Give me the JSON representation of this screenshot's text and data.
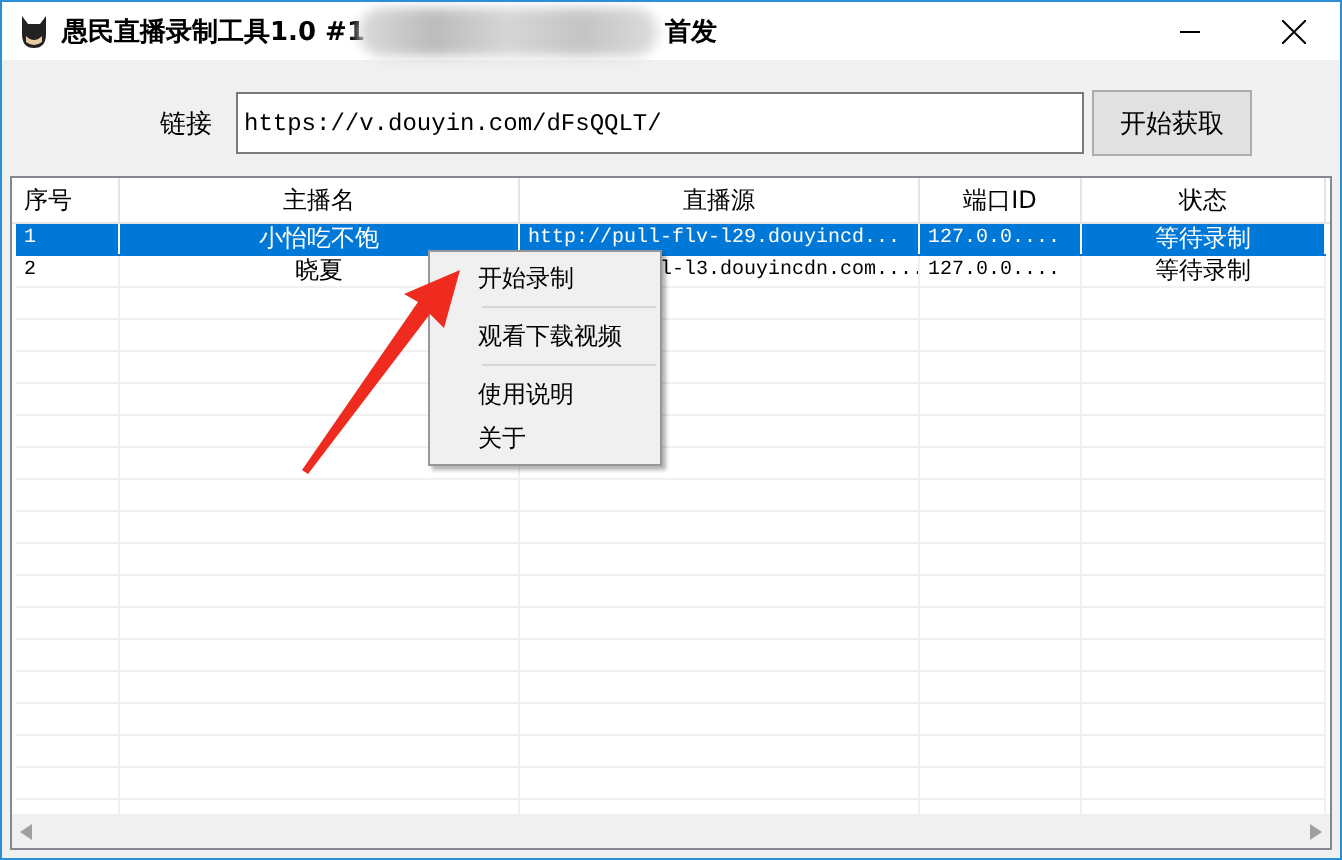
{
  "window": {
    "title_start": "愚民直播录制工具1.0 #1",
    "title_end": "首发"
  },
  "link": {
    "label": "链接",
    "value": "https://v.douyin.com/dFsQQLT/",
    "button": "开始获取"
  },
  "table": {
    "columns": [
      "序号",
      "主播名",
      "直播源",
      "端口ID",
      "状态"
    ],
    "rows": [
      {
        "selected": true,
        "covered": false,
        "cells": [
          "1",
          "小怡吃不饱",
          "http://pull-flv-l29.douyincd...",
          "127.0.0....",
          "等待录制"
        ]
      },
      {
        "selected": false,
        "covered": true,
        "cells": [
          "2",
          "晓夏",
          "l-l3.douyincdn.com....",
          "127.0.0....",
          "等待录制"
        ]
      }
    ]
  },
  "context_menu": {
    "items": [
      {
        "kind": "item",
        "label": "开始录制"
      },
      {
        "kind": "separator"
      },
      {
        "kind": "item",
        "label": "观看下载视频"
      },
      {
        "kind": "separator"
      },
      {
        "kind": "item",
        "label": "使用说明"
      },
      {
        "kind": "item",
        "label": "关于"
      }
    ]
  }
}
